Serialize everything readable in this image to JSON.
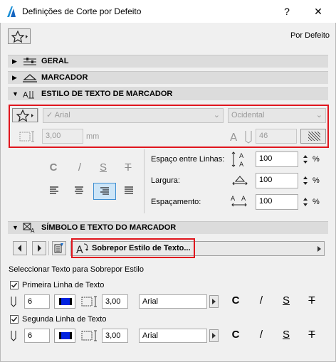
{
  "window": {
    "title": "Definições de Corte por Defeito",
    "help_label": "?",
    "close_label": "✕"
  },
  "favorites": {
    "label": "Por Defeito"
  },
  "sections": {
    "geral": "GERAL",
    "marcador": "MARCADOR",
    "estilo_texto": "ESTILO DE TEXTO DE MARCADOR",
    "simbolo_texto": "SÍMBOLO E TEXTO DO MARCADOR"
  },
  "text_style": {
    "font": "Arial",
    "script": "Ocidental",
    "height_value": "3,00",
    "height_unit": "mm",
    "pen_value": "46"
  },
  "style_buttons": {
    "bold": "C",
    "italic": "/",
    "underline": "S",
    "strike": "T"
  },
  "spacing": {
    "line_spacing_label": "Espaço entre Linhas:",
    "line_spacing_value": "100",
    "width_label": "Largura:",
    "width_value": "100",
    "spacing_label": "Espaçamento:",
    "spacing_value": "100",
    "unit": "%"
  },
  "override": {
    "label": "Sobrepor Estilo de Texto...",
    "select_label": "Seleccionar Texto para Sobrepor Estilo"
  },
  "line1": {
    "label": "Primeira Linha de Texto",
    "checked": true,
    "pen": "6",
    "height": "3,00",
    "font": "Arial"
  },
  "line2": {
    "label": "Segunda Linha de Texto",
    "checked": true,
    "pen": "6",
    "height": "3,00",
    "font": "Arial"
  },
  "colors": {
    "accent": "#e0151d",
    "pen_blue": "#0022e0"
  }
}
